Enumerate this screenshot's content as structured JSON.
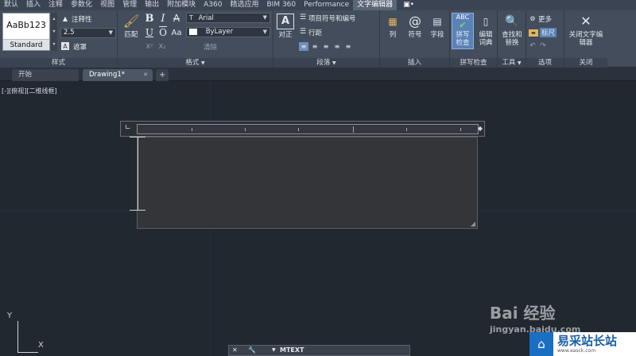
{
  "ribbon_tabs": [
    "默认",
    "插入",
    "注释",
    "参数化",
    "视图",
    "管理",
    "输出",
    "附加模块",
    "A360",
    "精选应用",
    "BIM 360",
    "Performance",
    "文字编辑器",
    "▣•"
  ],
  "active_tab": "文字编辑器",
  "style_panel": {
    "preview": "AaBb123",
    "style_name": "Standard",
    "annotative": "注释性",
    "height_value": "2.5",
    "mask": "遮罩",
    "title": "样式"
  },
  "format_panel": {
    "match": "匹配",
    "bold": "B",
    "italic": "I",
    "strike": "A",
    "underline": "U",
    "overline": "O",
    "case": "Aa",
    "font": "Arial",
    "color": "ByLayer",
    "superscript": "X²",
    "subscript": "X₂",
    "clear": "清除",
    "title": "格式"
  },
  "paragraph_panel": {
    "justify": "对正",
    "bullets": "项目符号和编号",
    "line_spacing": "行距",
    "title": "段落"
  },
  "insert_panel": {
    "columns": "列",
    "symbol": "符号",
    "field": "字段",
    "title": "插入"
  },
  "spell_panel": {
    "spell_check": "拼写检查",
    "edit_dict": "编辑词典",
    "title": "拼写检查"
  },
  "tools_panel": {
    "find_replace": "查找和替换",
    "title": "工具"
  },
  "options_panel": {
    "more": "更多",
    "ruler": "标尺",
    "title": "选项"
  },
  "close_panel": {
    "close": "关闭文字编辑器",
    "title": "关闭"
  },
  "file_tabs": [
    "开始",
    "Drawing1*"
  ],
  "view_label": "[-][俯视][二维线框]",
  "command": "MTEXT",
  "ucs": {
    "x": "X",
    "y": "Y"
  },
  "watermark": {
    "brand": "Bai 经验",
    "url": "jingyan.baidu.com",
    "badge": "易采站长站",
    "badge_sub": "www.easck.com"
  }
}
